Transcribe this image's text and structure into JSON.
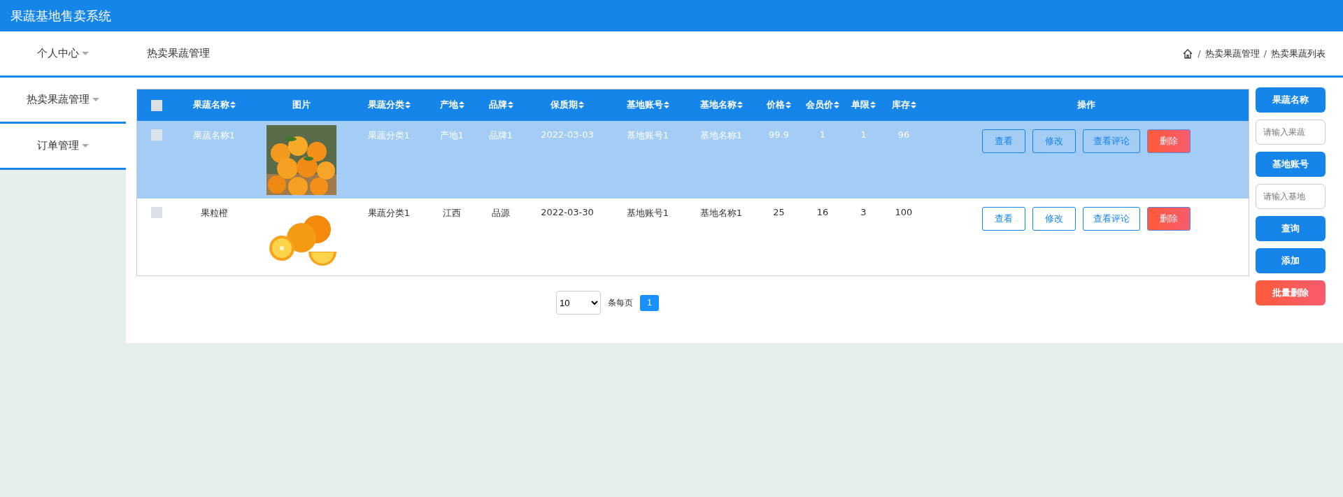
{
  "header": {
    "title": "果蔬基地售卖系统"
  },
  "sidebar": {
    "items": [
      {
        "label": "个人中心",
        "expanded": false
      },
      {
        "label": "热卖果蔬管理",
        "expanded": false
      },
      {
        "label": "订单管理",
        "expanded": false
      }
    ]
  },
  "page_title": "热卖果蔬管理",
  "breadcrumb": [
    {
      "kind": "separator",
      "text": "/"
    },
    {
      "kind": "link",
      "text": "热卖果蔬管理"
    },
    {
      "kind": "separator",
      "text": "/"
    },
    {
      "kind": "link",
      "text": "热卖果蔬列表"
    }
  ],
  "table": {
    "select_all": {
      "checked": false
    },
    "columns": [
      {
        "label": "果蔬名称",
        "sortable": true
      },
      {
        "label": "图片",
        "sortable": false
      },
      {
        "label": "果蔬分类",
        "sortable": true
      },
      {
        "label": "产地",
        "sortable": true
      },
      {
        "label": "品牌",
        "sortable": true
      },
      {
        "label": "保质期",
        "sortable": true
      },
      {
        "label": "基地账号",
        "sortable": true
      },
      {
        "label": "基地名称",
        "sortable": true
      },
      {
        "label": "价格",
        "sortable": true
      },
      {
        "label": "会员价",
        "sortable": true
      },
      {
        "label": "单限",
        "sortable": true
      },
      {
        "label": "库存",
        "sortable": true
      },
      {
        "label": "操作",
        "sortable": false
      }
    ],
    "rows": [
      {
        "selected": true,
        "checked": false,
        "cells": [
          "果蔬名称1",
          {
            "kind": "picture"
          },
          "果蔬分类1",
          "产地1",
          "品牌1",
          "2022-03-03",
          "基地账号1",
          "基地名称1",
          "99.9",
          "1",
          "1",
          "96"
        ],
        "actions": [
          {
            "label": "查看",
            "kind": "plain"
          },
          {
            "label": "修改",
            "kind": "plain"
          },
          {
            "label": "查看评论",
            "kind": "plain"
          },
          {
            "label": "删除",
            "kind": "danger"
          }
        ]
      },
      {
        "selected": false,
        "checked": false,
        "cells": [
          "果粒橙",
          {
            "kind": "picture"
          },
          "果蔬分类1",
          "江西",
          "品源",
          "2022-03-30",
          "基地账号1",
          "基地名称1",
          "25",
          "16",
          "3",
          "100"
        ],
        "actions": [
          {
            "label": "查看",
            "kind": "plain"
          },
          {
            "label": "修改",
            "kind": "plain"
          },
          {
            "label": "查看评论",
            "kind": "plain"
          },
          {
            "label": "删除",
            "kind": "danger"
          }
        ]
      }
    ]
  },
  "pagination": {
    "page_size": "10",
    "page_size_label": "条每页",
    "pages": [
      {
        "label": "1",
        "selected": true
      }
    ]
  },
  "search_panel": [
    {
      "kind": "label",
      "text": "果蔬名称"
    },
    {
      "kind": "input",
      "placeholder": "请输入果蔬"
    },
    {
      "kind": "label",
      "text": "基地账号"
    },
    {
      "kind": "input",
      "placeholder": "请输入基地"
    },
    {
      "kind": "button",
      "text": "查询"
    },
    {
      "kind": "button",
      "text": "添加"
    },
    {
      "kind": "danger",
      "text": "批量删除"
    }
  ]
}
